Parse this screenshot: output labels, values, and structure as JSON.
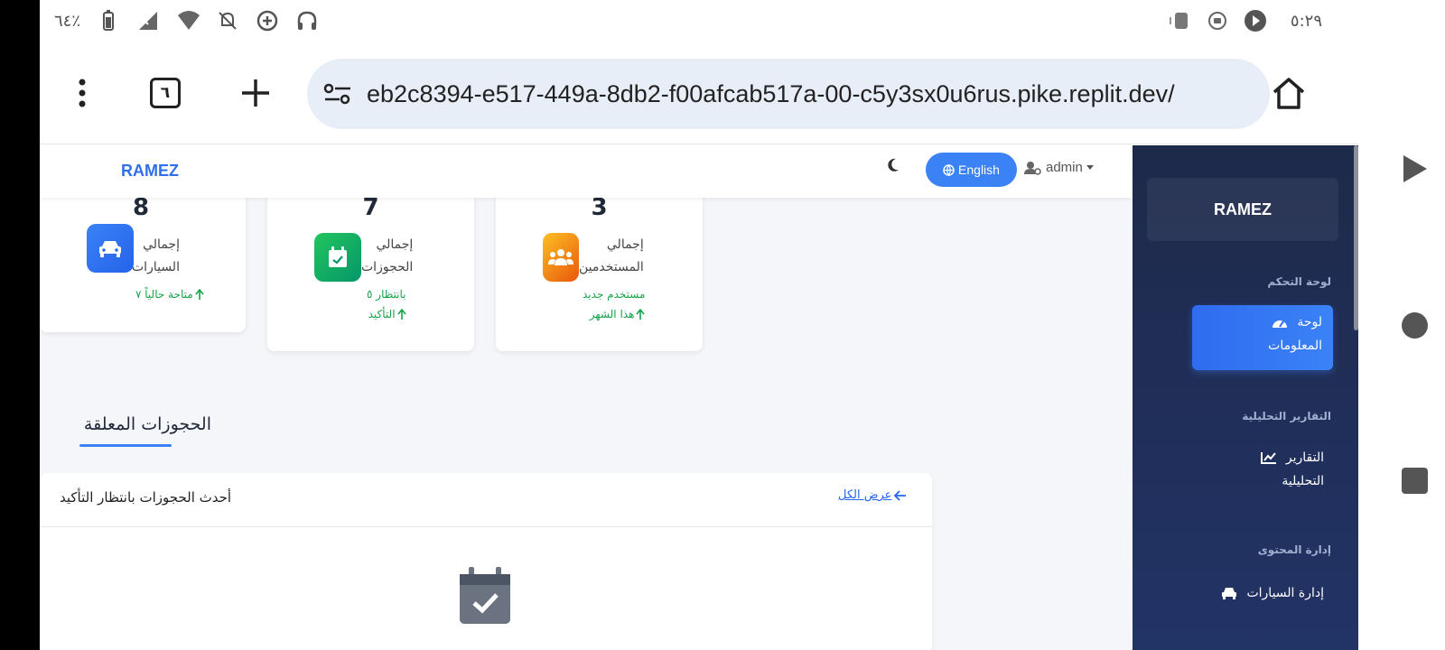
{
  "status_bar": {
    "battery": "٦٤٪",
    "time": "٥:٢٩"
  },
  "browser": {
    "tab_count": "٦",
    "url": "eb2c8394-e517-449a-8db2-f00afcab517a-00-c5y3sx0u6rus.pike.replit.dev/"
  },
  "topnav": {
    "brand": "RAMEZ",
    "lang_label": "English",
    "user_label": "admin"
  },
  "cards": [
    {
      "value": "8",
      "label_1": "إجمالي",
      "label_2": "السيارات",
      "sub": "متاحة حالياً ٧",
      "icon": "car-icon",
      "color": "#3b82f6"
    },
    {
      "value": "7",
      "label_1": "إجمالي",
      "label_2": "الحجوزات",
      "sub_1": "بانتظار ٥",
      "sub_2": "التأكيد",
      "icon": "calendar-check-icon",
      "color": "#10b981"
    },
    {
      "value": "3",
      "label_1": "إجمالي",
      "label_2": "المستخدمين",
      "sub_1": "مستخدم جديد",
      "sub_2": "هذا الشهر",
      "icon": "users-icon",
      "color": "#f59e0b"
    }
  ],
  "pending": {
    "section_title": "الحجوزات المعلقة",
    "card_title": "أحدث الحجوزات بانتظار التأكيد",
    "view_all": "عرض الكل"
  },
  "sidebar": {
    "brand": "RAMEZ",
    "sections": [
      {
        "title": "لوحة التحكم",
        "items": [
          {
            "label_1": "لوحة",
            "label_2": "المعلومات",
            "icon": "dashboard-icon",
            "active": true
          }
        ]
      },
      {
        "title": "التقارير التحليلية",
        "items": [
          {
            "label_1": "التقارير",
            "label_2": "التحليلية",
            "icon": "chart-line-icon"
          }
        ]
      },
      {
        "title": "إدارة المحتوى",
        "items": [
          {
            "label_1": "إدارة السيارات",
            "icon": "car-icon"
          }
        ]
      }
    ]
  }
}
